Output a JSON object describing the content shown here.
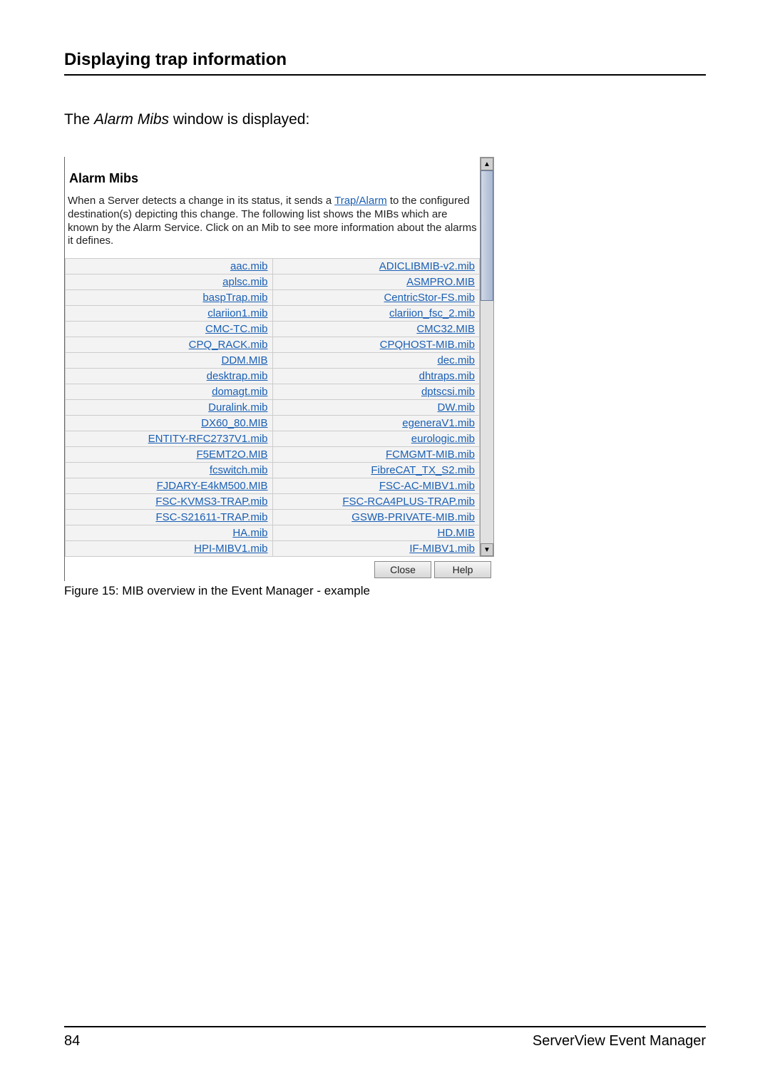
{
  "section_title": "Displaying trap information",
  "intro_prefix": "The ",
  "intro_italic": "Alarm Mibs",
  "intro_suffix": " window is displayed:",
  "window": {
    "heading": "Alarm Mibs",
    "desc_before": "When a Server detects a change in its status, it sends a ",
    "desc_link": "Trap/Alarm",
    "desc_after": " to the configured destination(s) depicting this change. The following list shows the MIBs which are known by the Alarm Service. Click on an Mib to see more information about the alarms it defines.",
    "close_label": "Close",
    "help_label": "Help"
  },
  "mib_rows": [
    {
      "left": "aac.mib",
      "right": "ADICLIBMIB-v2.mib"
    },
    {
      "left": "aplsc.mib",
      "right": "ASMPRO.MIB"
    },
    {
      "left": "baspTrap.mib",
      "right": "CentricStor-FS.mib"
    },
    {
      "left": "clariion1.mib",
      "right": "clariion_fsc_2.mib"
    },
    {
      "left": "CMC-TC.mib",
      "right": "CMC32.MIB"
    },
    {
      "left": "CPQ_RACK.mib",
      "right": "CPQHOST-MIB.mib"
    },
    {
      "left": "DDM.MIB",
      "right": "dec.mib"
    },
    {
      "left": "desktrap.mib",
      "right": "dhtraps.mib"
    },
    {
      "left": "domagt.mib",
      "right": "dptscsi.mib"
    },
    {
      "left": "Duralink.mib",
      "right": "DW.mib"
    },
    {
      "left": "DX60_80.MIB",
      "right": "egeneraV1.mib"
    },
    {
      "left": "ENTITY-RFC2737V1.mib",
      "right": "eurologic.mib"
    },
    {
      "left": "F5EMT2O.MIB",
      "right": "FCMGMT-MIB.mib"
    },
    {
      "left": "fcswitch.mib",
      "right": "FibreCAT_TX_S2.mib"
    },
    {
      "left": "FJDARY-E4kM500.MIB",
      "right": "FSC-AC-MIBV1.mib"
    },
    {
      "left": "FSC-KVMS3-TRAP.mib",
      "right": "FSC-RCA4PLUS-TRAP.mib"
    },
    {
      "left": "FSC-S21611-TRAP.mib",
      "right": "GSWB-PRIVATE-MIB.mib"
    },
    {
      "left": "HA.mib",
      "right": "HD.MIB"
    },
    {
      "left": "HPI-MIBV1.mib",
      "right": "IF-MIBV1.mib"
    }
  ],
  "figure_caption": "Figure 15: MIB overview in the Event Manager - example",
  "footer": {
    "page": "84",
    "doc": "ServerView Event Manager"
  }
}
